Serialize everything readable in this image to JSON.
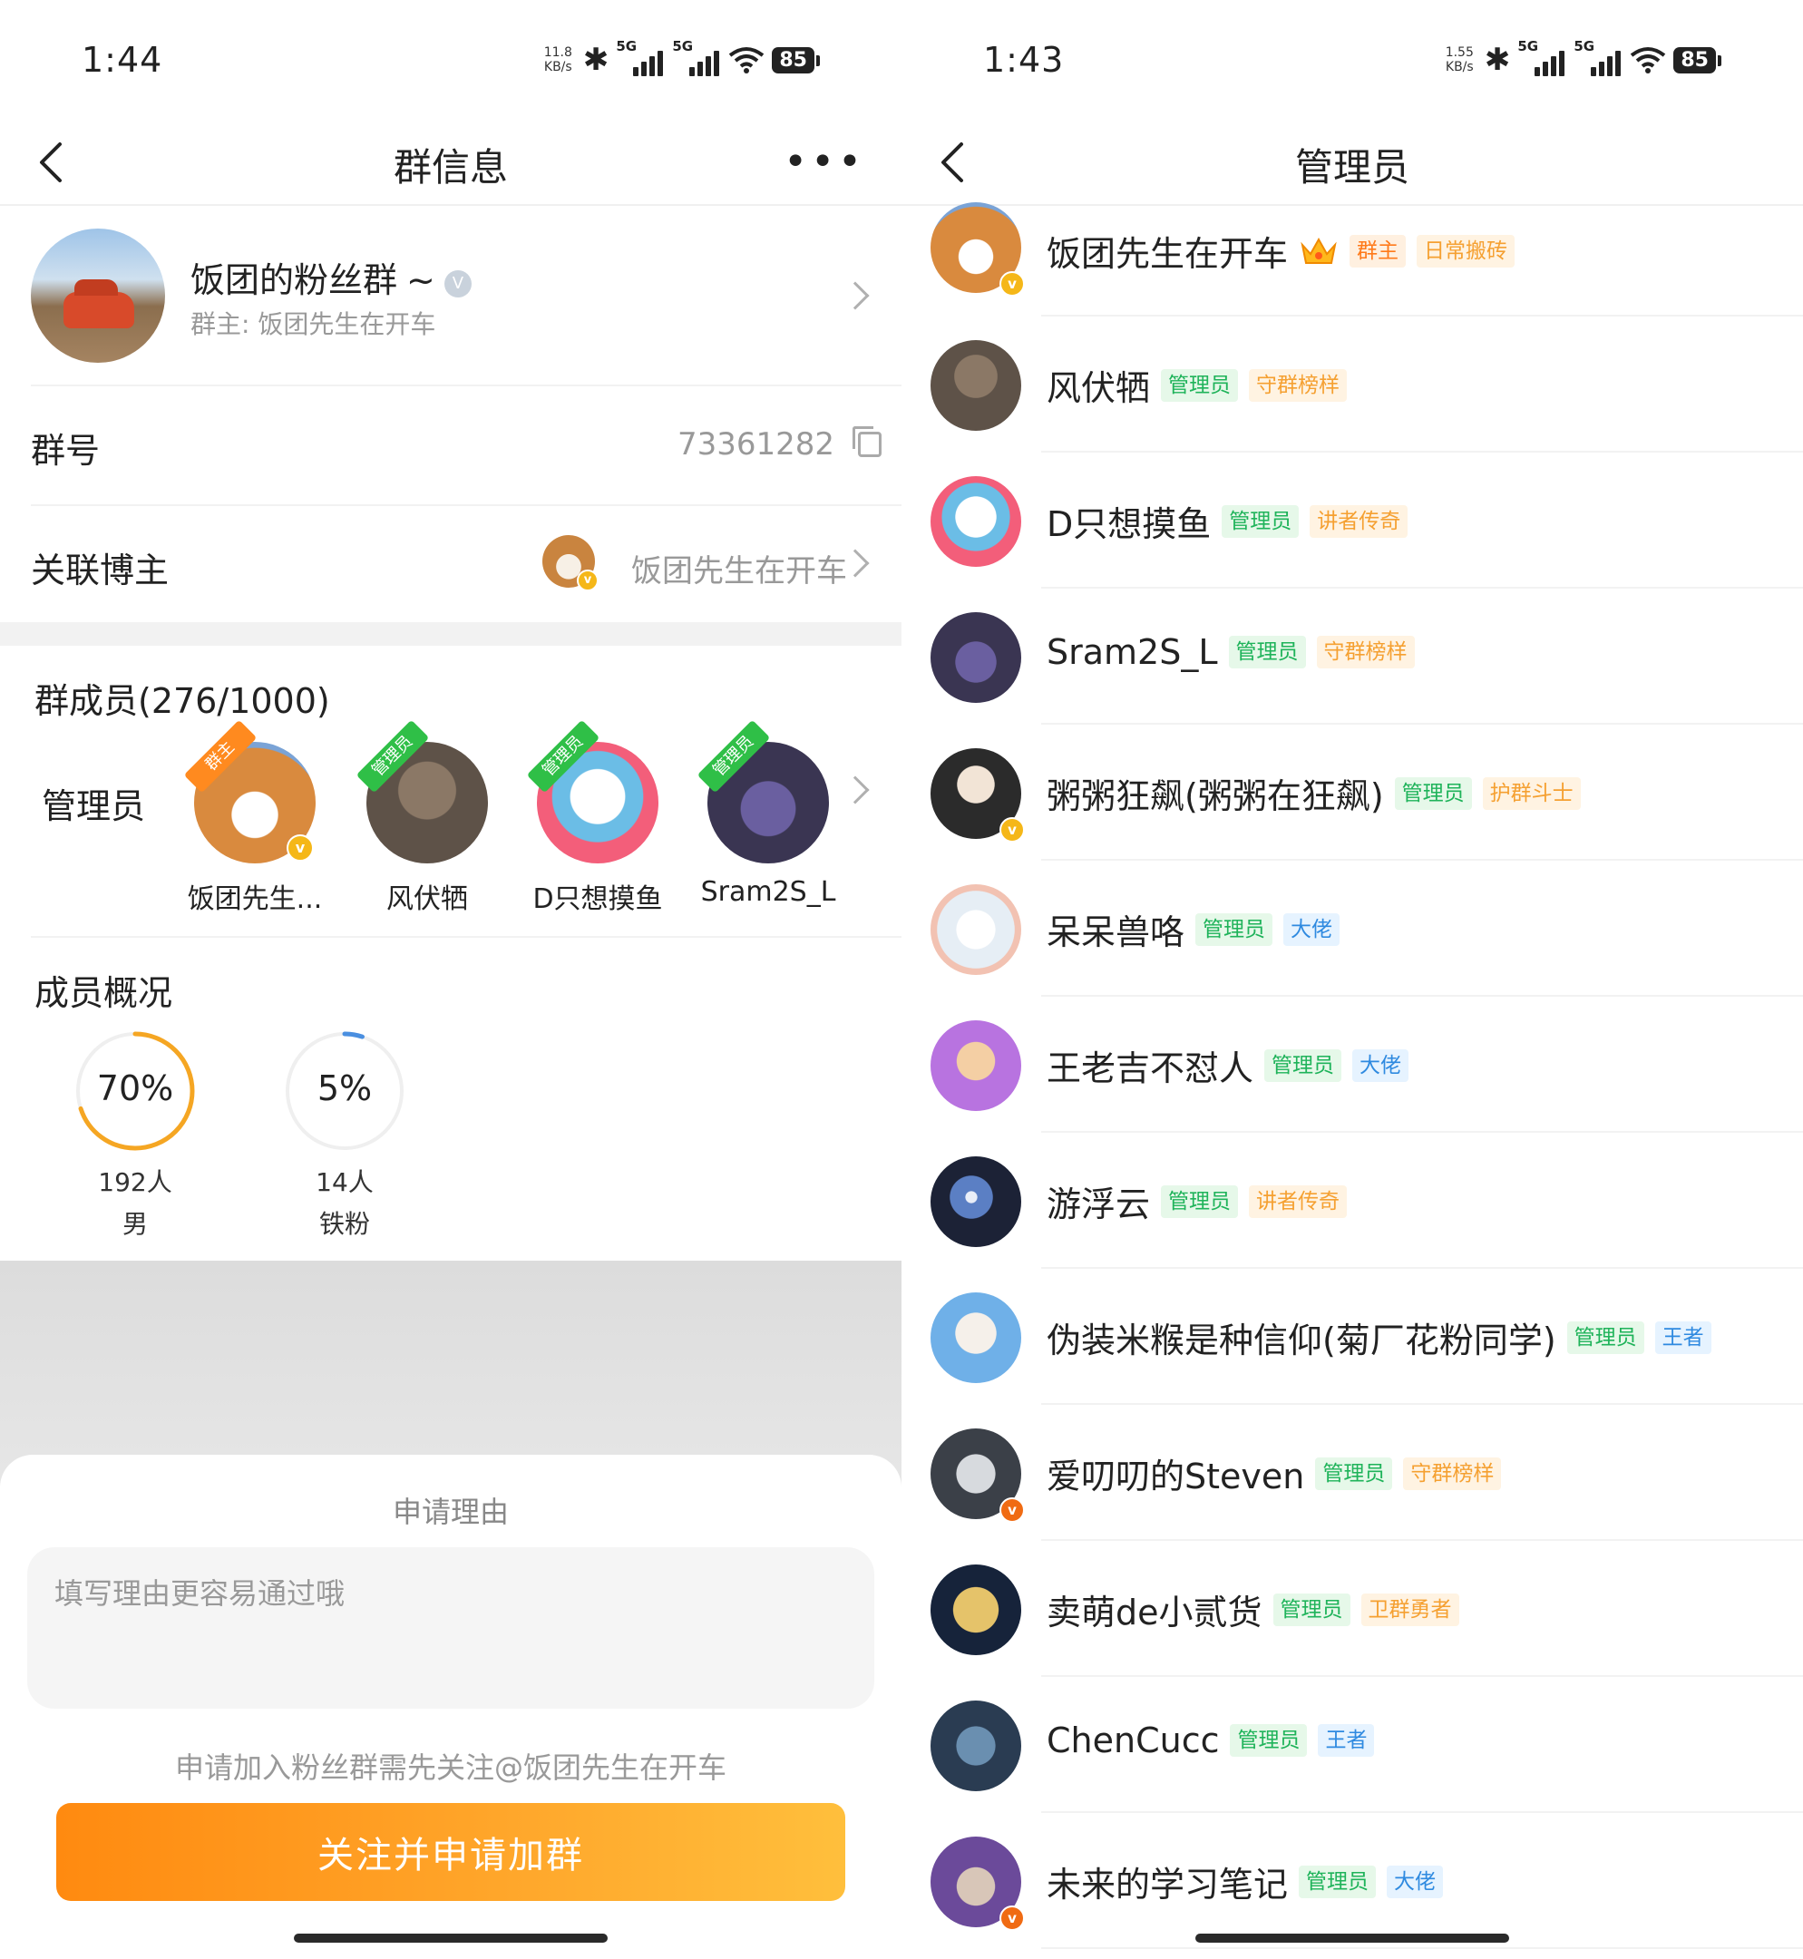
{
  "left": {
    "status": {
      "time": "1:44",
      "speed_value": "11.8",
      "speed_unit": "KB/s",
      "net1": "5G",
      "net2": "5G",
      "battery": "85"
    },
    "nav": {
      "title": "群信息",
      "more": "•••"
    },
    "group": {
      "name": "饭团的粉丝群",
      "tilde": "~",
      "owner": "群主: 饭团先生在开车"
    },
    "group_id": {
      "label": "群号",
      "value": "73361282"
    },
    "linked_blogger": {
      "label": "关联博主",
      "name": "饭团先生在开车"
    },
    "members": {
      "title": "群成员(276/1000)",
      "admin_label": "管理员",
      "list": [
        {
          "name": "饭团先生...",
          "tag": "群主"
        },
        {
          "name": "风伏牺",
          "tag": "管理员"
        },
        {
          "name": "D只想摸鱼",
          "tag": "管理员"
        },
        {
          "name": "Sram2S_L",
          "tag": "管理员"
        }
      ]
    },
    "stats": {
      "title": "成员概况",
      "items": [
        {
          "percent_text": "70%",
          "percent": 0.7,
          "count": "192人",
          "label": "男",
          "color": "#f5a623"
        },
        {
          "percent_text": "5%",
          "percent": 0.05,
          "count": "14人",
          "label": "铁粉",
          "color": "#4a8fe0"
        }
      ]
    },
    "sheet": {
      "title": "申请理由",
      "placeholder": "填写理由更容易通过哦",
      "hint": "申请加入粉丝群需先关注@饭团先生在开车",
      "button": "关注并申请加群"
    }
  },
  "right": {
    "status": {
      "time": "1:43",
      "speed_value": "1.55",
      "speed_unit": "KB/s",
      "net1": "5G",
      "net2": "5G",
      "battery": "85"
    },
    "nav": {
      "title": "管理员"
    },
    "admins": [
      {
        "name": "饭团先生在开车",
        "crown": true,
        "badges": [
          {
            "text": "群主",
            "style": "owner"
          },
          {
            "text": "日常搬砖",
            "style": "orange"
          }
        ]
      },
      {
        "name": "风伏牺",
        "badges": [
          {
            "text": "管理员",
            "style": "admin"
          },
          {
            "text": "守群榜样",
            "style": "orange"
          }
        ]
      },
      {
        "name": "D只想摸鱼",
        "badges": [
          {
            "text": "管理员",
            "style": "admin"
          },
          {
            "text": "讲者传奇",
            "style": "orange"
          }
        ]
      },
      {
        "name": "Sram2S_L",
        "badges": [
          {
            "text": "管理员",
            "style": "admin"
          },
          {
            "text": "守群榜样",
            "style": "orange"
          }
        ]
      },
      {
        "name": "粥粥狂飙(粥粥在狂飙)",
        "badges": [
          {
            "text": "管理员",
            "style": "admin"
          },
          {
            "text": "护群斗士",
            "style": "orange"
          }
        ]
      },
      {
        "name": "呆呆兽咯",
        "badges": [
          {
            "text": "管理员",
            "style": "admin"
          },
          {
            "text": "大佬",
            "style": "blue"
          }
        ]
      },
      {
        "name": "王老吉不怼人",
        "badges": [
          {
            "text": "管理员",
            "style": "admin"
          },
          {
            "text": "大佬",
            "style": "blue"
          }
        ]
      },
      {
        "name": "游浮云",
        "badges": [
          {
            "text": "管理员",
            "style": "admin"
          },
          {
            "text": "讲者传奇",
            "style": "orange"
          }
        ]
      },
      {
        "name": "伪装米糇是种信仰(菊厂花粉同学)",
        "badges": [
          {
            "text": "管理员",
            "style": "admin"
          },
          {
            "text": "王者",
            "style": "blue"
          }
        ]
      },
      {
        "name": "爱叨叨的Steven",
        "badges": [
          {
            "text": "管理员",
            "style": "admin"
          },
          {
            "text": "守群榜样",
            "style": "orange"
          }
        ]
      },
      {
        "name": "卖萌de小贰货",
        "badges": [
          {
            "text": "管理员",
            "style": "admin"
          },
          {
            "text": "卫群勇者",
            "style": "orange"
          }
        ]
      },
      {
        "name": "ChenCucc",
        "badges": [
          {
            "text": "管理员",
            "style": "admin"
          },
          {
            "text": "王者",
            "style": "blue"
          }
        ]
      },
      {
        "name": "未来的学习笔记",
        "badges": [
          {
            "text": "管理员",
            "style": "admin"
          },
          {
            "text": "大佬",
            "style": "blue"
          }
        ]
      }
    ]
  }
}
